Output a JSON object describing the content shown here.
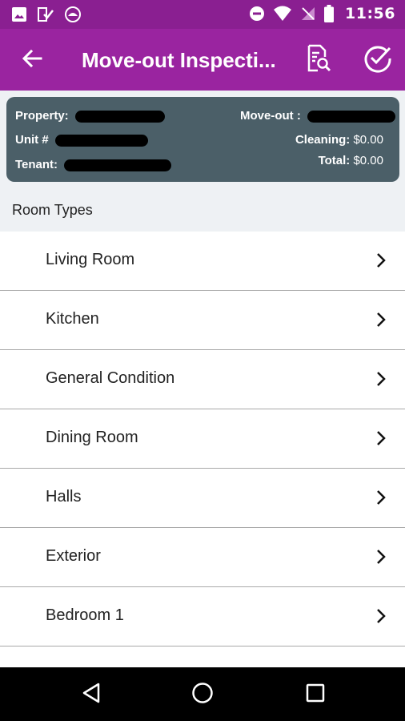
{
  "status_bar": {
    "time": "11:56",
    "left_icons": [
      "image-icon",
      "checklist-icon",
      "app-icon"
    ],
    "right_icons": [
      "do-not-disturb-icon",
      "wifi-icon",
      "no-signal-icon",
      "battery-icon"
    ]
  },
  "toolbar": {
    "title": "Move-out Inspecti...",
    "back_icon": "arrow-left-icon",
    "preview_icon": "document-search-icon",
    "submit_icon": "check-circle-icon"
  },
  "summary": {
    "property_label": "Property:",
    "unit_label": "Unit #",
    "tenant_label": "Tenant:",
    "moveout_label": "Move-out :",
    "cleaning_label": "Cleaning:",
    "cleaning_value": "$0.00",
    "total_label": "Total:",
    "total_value": "$0.00"
  },
  "section_title": "Room Types",
  "rooms": [
    {
      "label": "Living Room"
    },
    {
      "label": "Kitchen"
    },
    {
      "label": "General Condition"
    },
    {
      "label": "Dining Room"
    },
    {
      "label": "Halls"
    },
    {
      "label": "Exterior"
    },
    {
      "label": "Bedroom 1"
    }
  ],
  "colors": {
    "toolbar": "#9a24a0",
    "status_bar": "#8a1f91",
    "card": "#4b5f68"
  }
}
